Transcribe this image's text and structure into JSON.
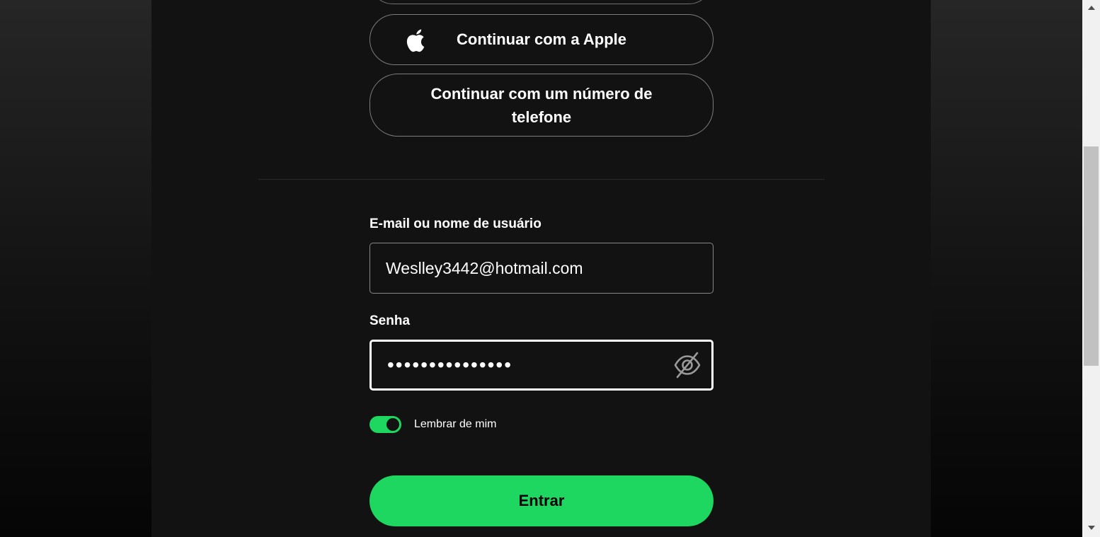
{
  "login": {
    "apple_button_label": "Continuar com a Apple",
    "phone_button_label": "Continuar com um número de telefone",
    "email_label": "E-mail ou nome de usuário",
    "email_value": "Weslley3442@hotmail.com",
    "password_label": "Senha",
    "password_value": "•••••••••••••••",
    "remember_label": "Lembrar de mim",
    "remember_enabled": true,
    "submit_label": "Entrar"
  },
  "icons": {
    "apple": "apple-icon",
    "password_visibility": "eye-off-icon"
  },
  "colors": {
    "accent": "#1ed760",
    "background": "#121212",
    "text": "#ffffff"
  }
}
